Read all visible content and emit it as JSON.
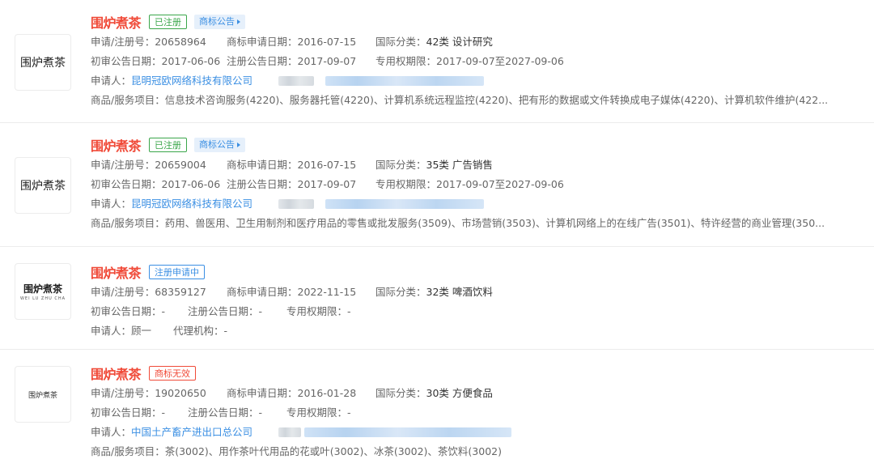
{
  "labels": {
    "reg_no": "申请/注册号：",
    "apply_date": "商标申请日期：",
    "intl_class": "国际分类：",
    "prelim_date": "初审公告日期：",
    "reg_date": "注册公告日期：",
    "exclusive": "专用权期限：",
    "applicant": "申请人：",
    "agent": "代理机构：",
    "goods": "商品/服务项目："
  },
  "records": [
    {
      "name": "围炉煮茶",
      "logo_text": "围炉煮茶",
      "status": "已注册",
      "announce": "商标公告",
      "reg_no": "20658964",
      "apply_date": "2016-07-15",
      "intl_class": "42类 设计研究",
      "prelim_date": "2017-06-06",
      "reg_date": "2017-09-07",
      "exclusive": "2017-09-07至2027-09-06",
      "applicant": "昆明冠欧网络科技有限公司",
      "goods": "信息技术咨询服务(4220)、服务器托管(4220)、计算机系统远程监控(4220)、把有形的数据或文件转换成电子媒体(4220)、计算机软件维护(422..."
    },
    {
      "name": "围炉煮茶",
      "logo_text": "围炉煮茶",
      "status": "已注册",
      "announce": "商标公告",
      "reg_no": "20659004",
      "apply_date": "2016-07-15",
      "intl_class": "35类 广告销售",
      "prelim_date": "2017-06-06",
      "reg_date": "2017-09-07",
      "exclusive": "2017-09-07至2027-09-06",
      "applicant": "昆明冠欧网络科技有限公司",
      "goods": "药用、兽医用、卫生用制剂和医疗用品的零售或批发服务(3509)、市场营销(3503)、计算机网络上的在线广告(3501)、特许经营的商业管理(350..."
    },
    {
      "name": "围炉煮茶",
      "logo_text": "围炉煮茶",
      "logo_sub": "WEI LU ZHU CHA",
      "status": "注册申请中",
      "reg_no": "68359127",
      "apply_date": "2022-11-15",
      "intl_class": "32类 啤酒饮料",
      "prelim_date": "-",
      "reg_date": "-",
      "exclusive": "-",
      "applicant": "顾一",
      "agent": "-"
    },
    {
      "name": "围炉煮茶",
      "logo_text": "围炉煮茶",
      "status": "商标无效",
      "reg_no": "19020650",
      "apply_date": "2016-01-28",
      "intl_class": "30类 方便食品",
      "prelim_date": "-",
      "reg_date": "-",
      "exclusive": "-",
      "applicant": "中国土产畜产进出口总公司",
      "goods": "茶(3002)、用作茶叶代用品的花或叶(3002)、冰茶(3002)、茶饮料(3002)"
    }
  ]
}
